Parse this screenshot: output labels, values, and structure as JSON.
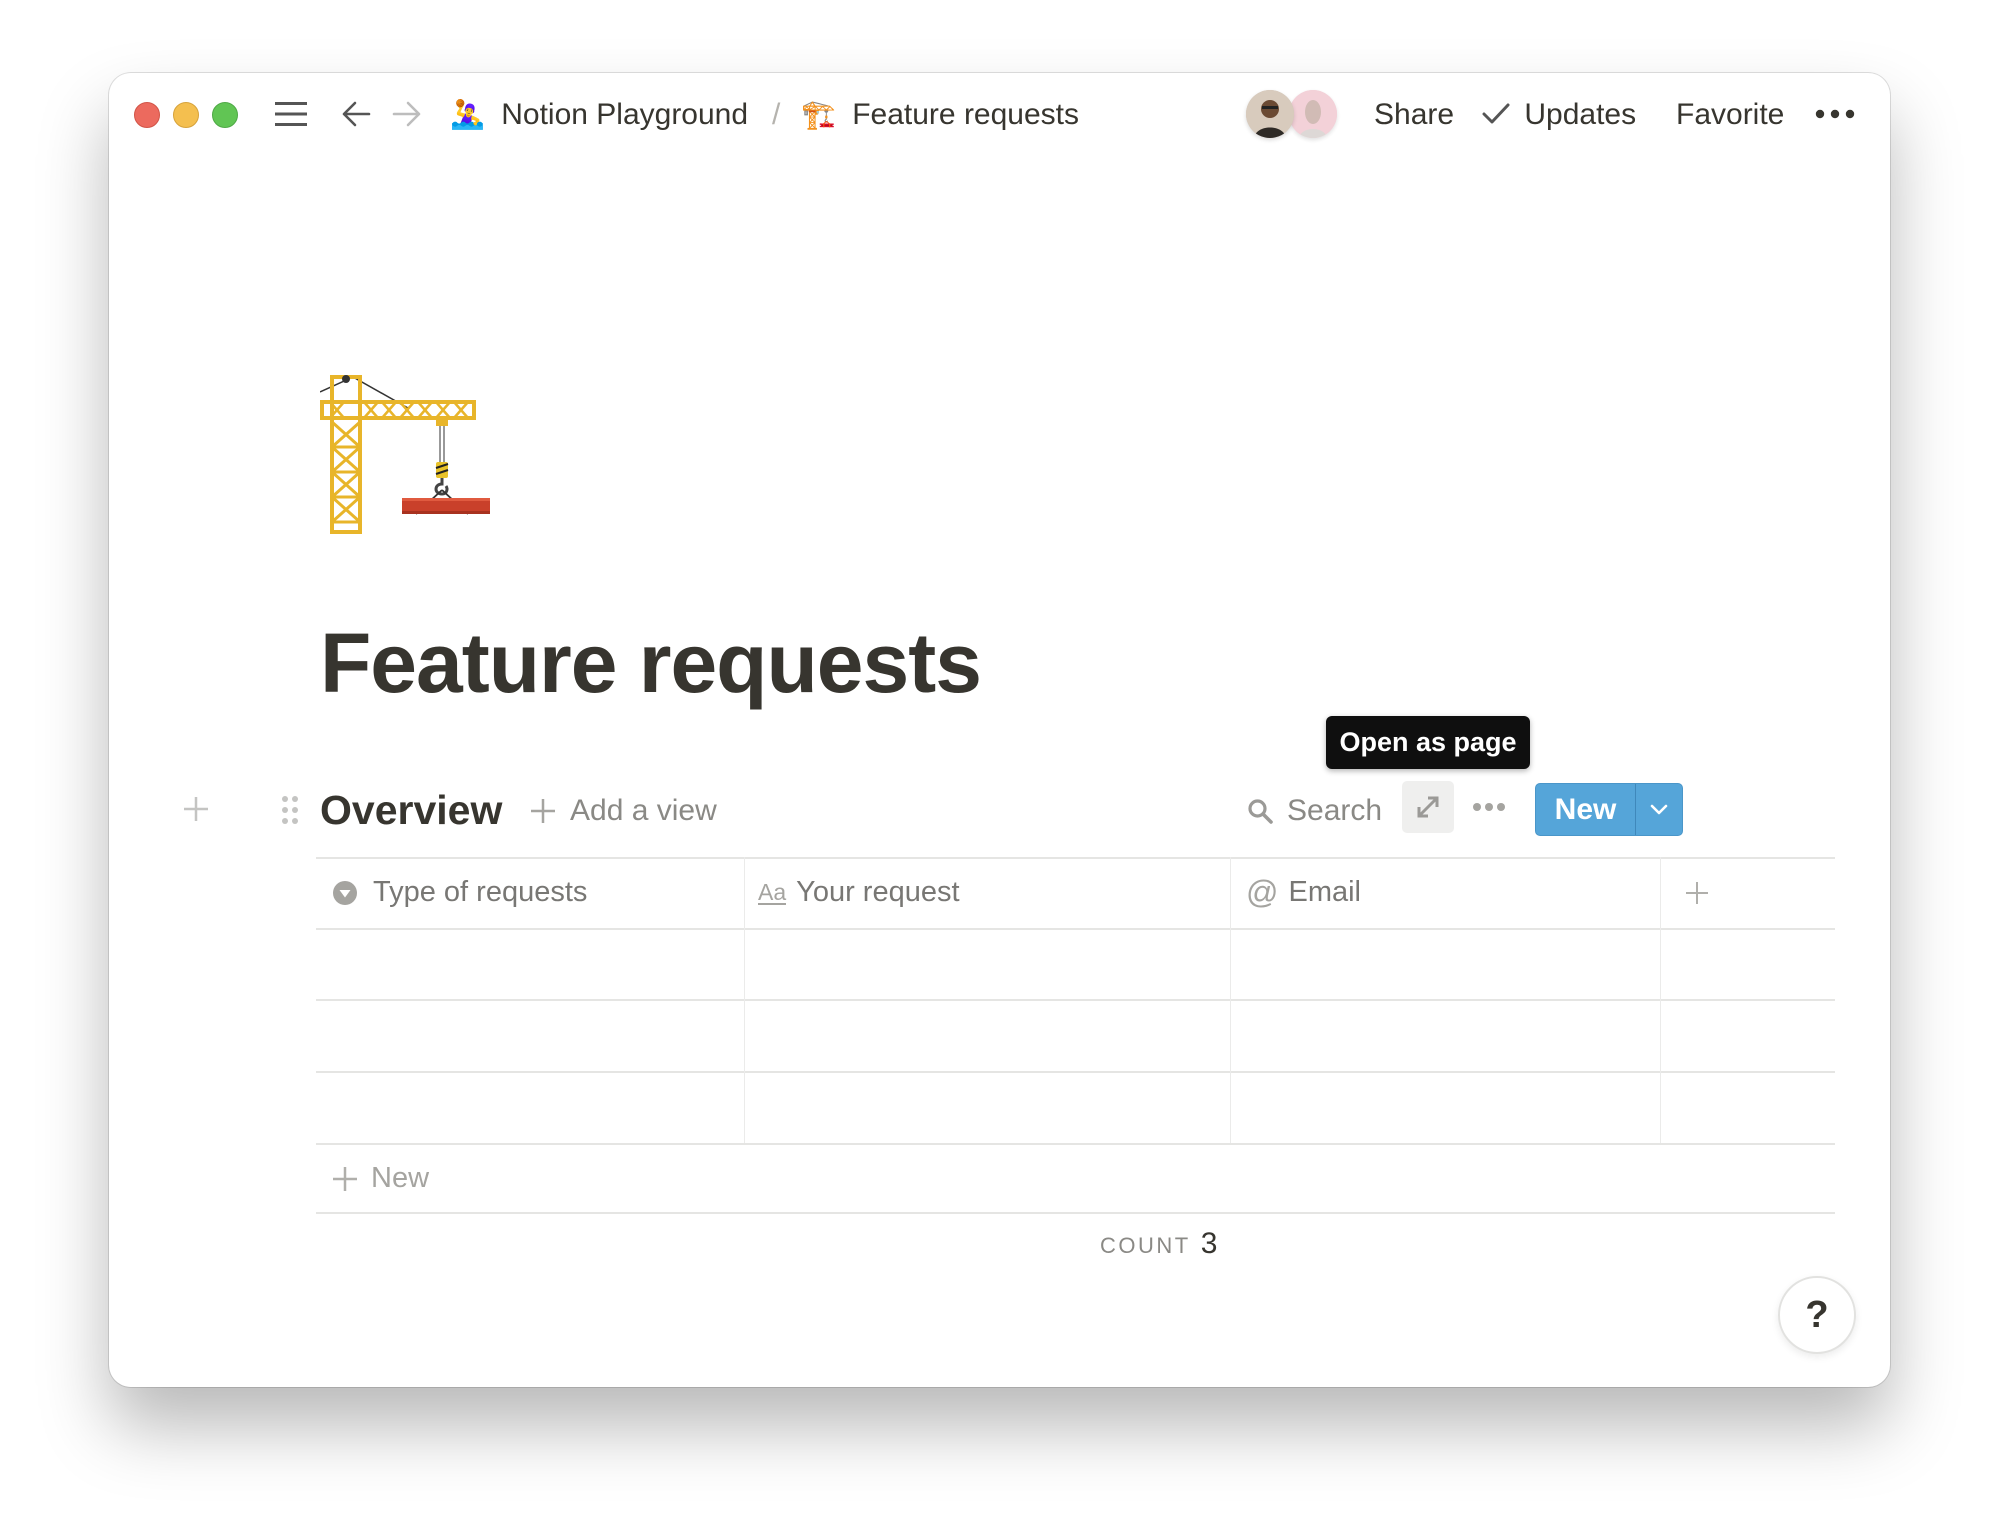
{
  "window": {
    "traffic_lights": [
      "close",
      "minimize",
      "zoom"
    ]
  },
  "topbar": {
    "breadcrumb": [
      {
        "icon": "🤽‍♀️",
        "icon_name": "water-polo-icon",
        "label": "Notion Playground"
      },
      {
        "icon": "🏗️",
        "icon_name": "crane-icon",
        "label": "Feature requests"
      }
    ],
    "separator": "/",
    "avatars": [
      "user-1",
      "user-2"
    ],
    "share_label": "Share",
    "updates_label": "Updates",
    "favorite_label": "Favorite",
    "more_label": "•••"
  },
  "page": {
    "icon": "🏗️",
    "title": "Feature requests"
  },
  "database": {
    "view_name": "Overview",
    "add_view_label": "Add a view",
    "search_label": "Search",
    "tooltip": "Open as page",
    "more_label": "•••",
    "new_button_label": "New",
    "columns": [
      {
        "icon": "select-icon",
        "label": "Type of requests"
      },
      {
        "icon": "title-icon",
        "icon_text": "Aa",
        "label": "Your request"
      },
      {
        "icon": "email-icon",
        "icon_text": "@",
        "label": "Email"
      }
    ],
    "add_column_label": "+",
    "rows": [
      {
        "type": "",
        "request": "",
        "email": ""
      },
      {
        "type": "",
        "request": "",
        "email": ""
      },
      {
        "type": "",
        "request": "",
        "email": ""
      }
    ],
    "new_row_label": "New",
    "count_label": "COUNT",
    "count_value": "3"
  },
  "help": {
    "label": "?"
  },
  "colors": {
    "accent": "#55a5d9",
    "text": "#37352f",
    "muted": "#787774",
    "tooltip_bg": "#0f0f0f"
  }
}
